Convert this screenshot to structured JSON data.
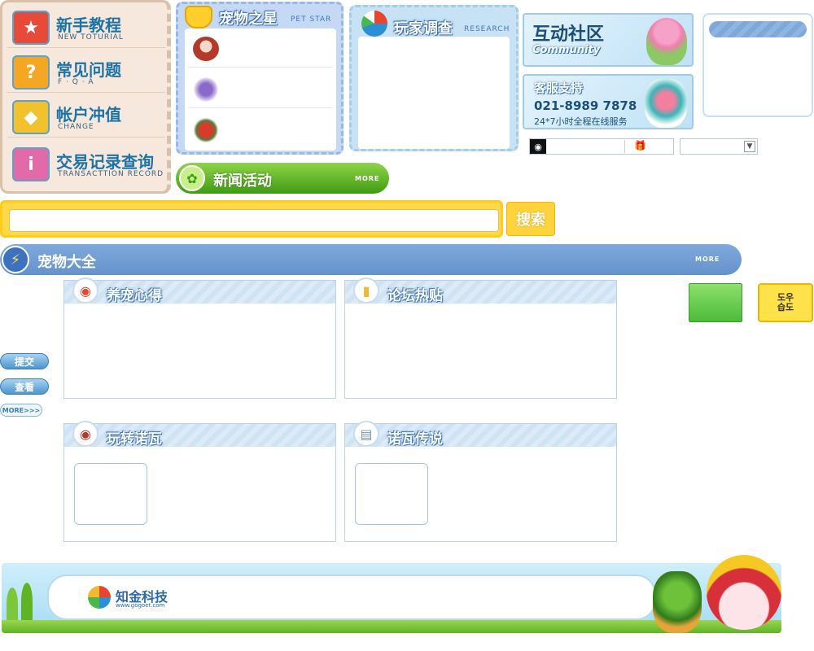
{
  "left_menu": [
    {
      "title": "新手教程",
      "sub": "NEW TOTURIAL",
      "icon": "tutorial-icon",
      "glyph": "★",
      "color": "#e84a3a"
    },
    {
      "title": "常见问题",
      "sub": "F · Q · A",
      "icon": "question-icon",
      "glyph": "?",
      "color": "#f5a623"
    },
    {
      "title": "帐户冲值",
      "sub": "CHANGE",
      "icon": "gold-ingot-icon",
      "glyph": "◆",
      "color": "#f2c12e"
    },
    {
      "title": "交易记录查询",
      "sub": "TRANSACTTION RECORD",
      "icon": "record-search-icon",
      "glyph": "i",
      "color": "#e26aa8"
    }
  ],
  "pet_star": {
    "title": "宠物之星",
    "sub": "PET STAR"
  },
  "research": {
    "title": "玩家调查",
    "sub": "RESEARCH"
  },
  "community": {
    "title": "互动社区",
    "sub": "Community"
  },
  "support": {
    "title": "客服支持",
    "phone": "021-8989 7878",
    "hours": "24*7小时全程在线服务"
  },
  "news": {
    "title": "新闻活动",
    "more": "MORE"
  },
  "search": {
    "placeholder": "",
    "button": "搜索"
  },
  "encyclopedia": {
    "title": "宠物大全",
    "more": "MORE"
  },
  "panels": [
    {
      "title": "养宠心得",
      "icon": "pet-care-icon"
    },
    {
      "title": "论坛热贴",
      "icon": "forum-icon"
    },
    {
      "title": "玩转诺瓦",
      "icon": "play-guide-icon"
    },
    {
      "title": "诺瓦传说",
      "icon": "legend-icon"
    }
  ],
  "side_buttons": {
    "submit": "提交",
    "view": "查看",
    "more": "MORE>>>"
  },
  "right_badge": {
    "label": "도우\n습도"
  },
  "footer": {
    "company": "知金科技",
    "url": "www.gogoet.com"
  },
  "colors": {
    "accent_blue": "#1d73a8",
    "search_yellow": "#ffd94a",
    "news_green": "#3f9b14",
    "bar_blue": "#6592cc"
  }
}
